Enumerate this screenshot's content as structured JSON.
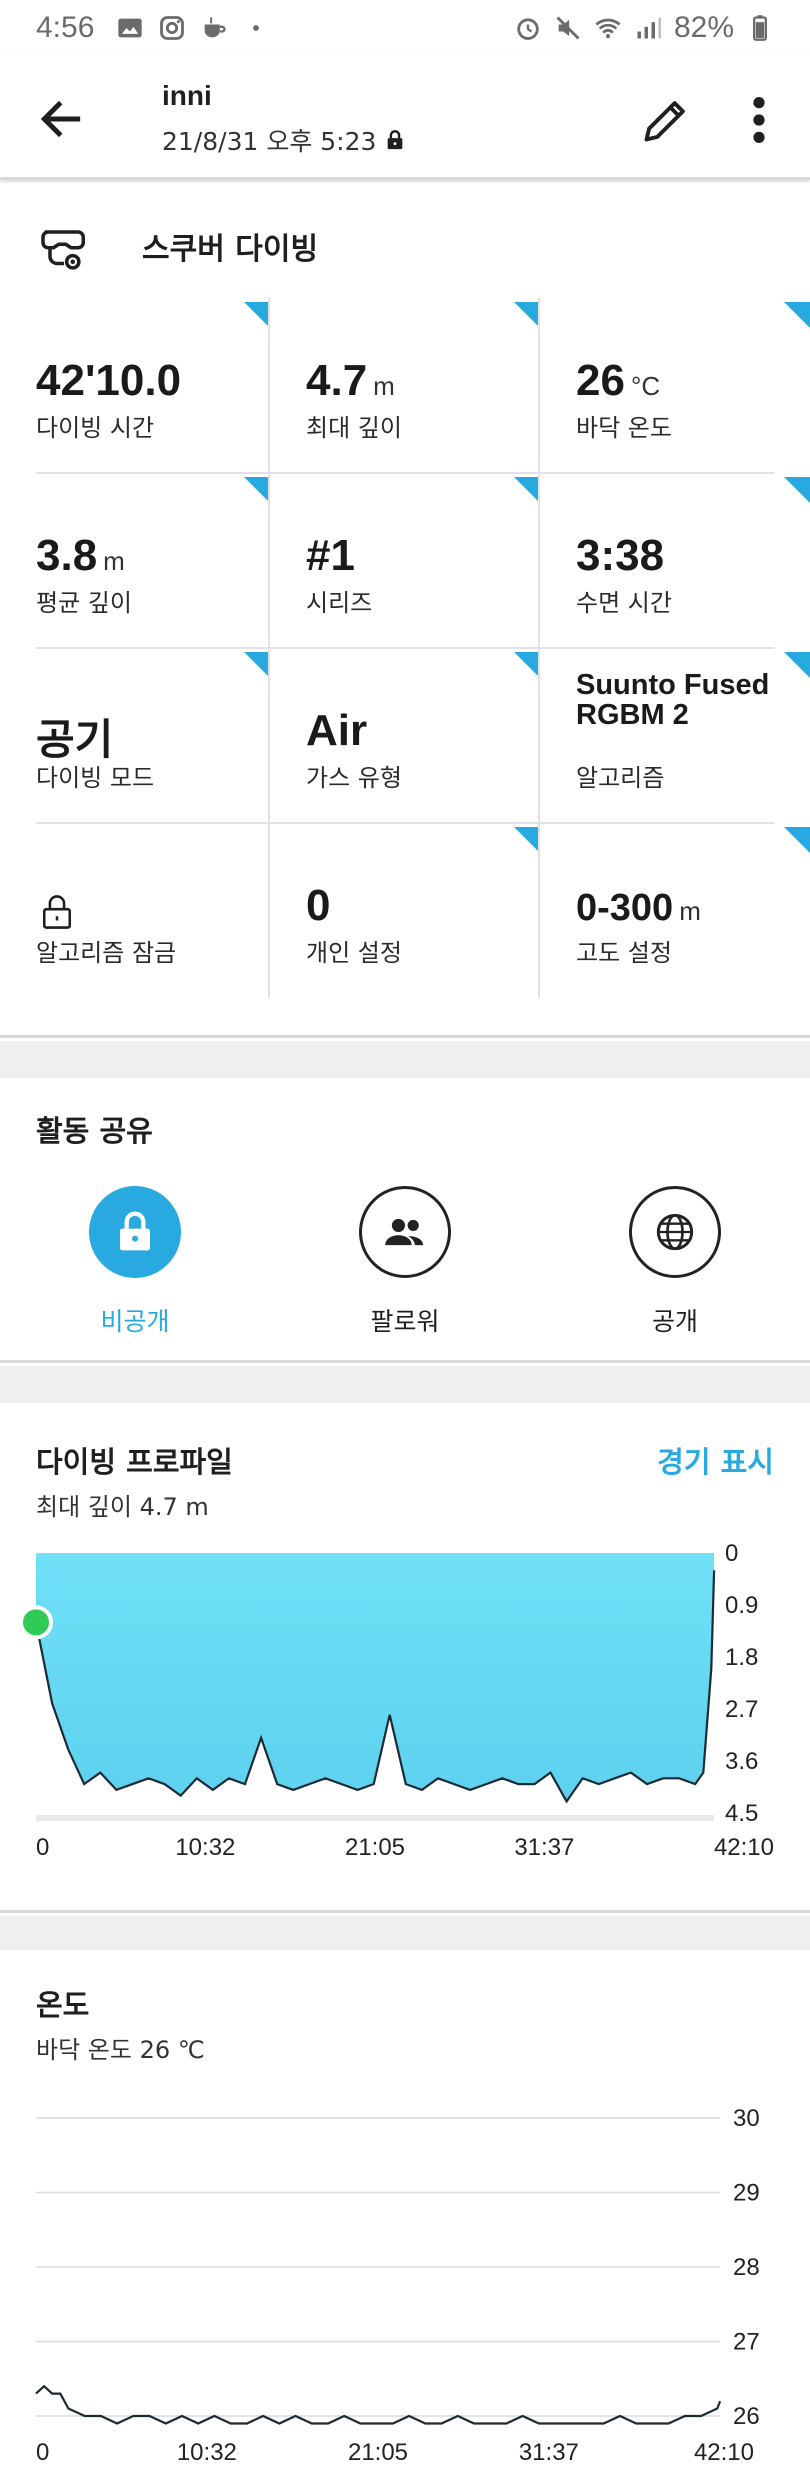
{
  "status_bar": {
    "time": "4:56",
    "battery": "82%",
    "icons": [
      "image-icon",
      "instagram-icon",
      "coffee-icon",
      "dot-icon",
      "alarm-icon",
      "mute-icon",
      "wifi-icon",
      "signal-icon",
      "battery-icon"
    ]
  },
  "header": {
    "title": "inni",
    "subtitle": "21/8/31 오후 5:23",
    "icons": [
      "back-arrow-icon",
      "lock-icon",
      "pencil-icon",
      "more-vert-icon"
    ]
  },
  "activity": {
    "icon": "scuba-icon",
    "label": "스쿠버 다이빙"
  },
  "stats": [
    {
      "value": "42'10.0",
      "unit": "",
      "label": "다이빙 시간"
    },
    {
      "value": "4.7",
      "unit": "m",
      "label": "최대 깊이"
    },
    {
      "value": "26",
      "unit": "°C",
      "label": "바닥 온도"
    },
    {
      "value": "3.8",
      "unit": "m",
      "label": "평균 깊이"
    },
    {
      "value": "#1",
      "unit": "",
      "label": "시리즈"
    },
    {
      "value": "3:38",
      "unit": "",
      "label": "수면 시간"
    },
    {
      "value": "공기",
      "unit": "",
      "label": "다이빙 모드"
    },
    {
      "value": "Air",
      "unit": "",
      "label": "가스 유형"
    },
    {
      "value": "Suunto Fused RGBM 2",
      "unit": "",
      "label": "알고리즘"
    },
    {
      "value": "",
      "unit": "",
      "label": "알고리즘 잠금",
      "icon": "padlock-icon"
    },
    {
      "value": "0",
      "unit": "",
      "label": "개인 설정"
    },
    {
      "value": "0-300",
      "unit": "m",
      "label": "고도 설정"
    }
  ],
  "accent_color": "#28a9e0",
  "share": {
    "title": "활동 공유",
    "options": [
      {
        "label": "비공개",
        "icon": "lock-icon",
        "selected": true
      },
      {
        "label": "팔로워",
        "icon": "people-icon",
        "selected": false
      },
      {
        "label": "공개",
        "icon": "globe-icon",
        "selected": false
      }
    ]
  },
  "profile": {
    "title": "다이빙 프로파일",
    "subtitle": "최대 깊이 4.7 m",
    "link": "경기 표시"
  },
  "temperature": {
    "title": "온도",
    "subtitle": "바닥 온도 26 ℃"
  },
  "chart_data": [
    {
      "type": "area",
      "x_ticks": [
        "0",
        "10:32",
        "21:05",
        "31:37",
        "42:10"
      ],
      "y_ticks": [
        "0",
        "0.9",
        "1.8",
        "2.7",
        "3.6",
        "4.5"
      ],
      "ylim": [
        0,
        4.5
      ],
      "y_inverted": true,
      "x": [
        0,
        1,
        2,
        3,
        4,
        5,
        7,
        8,
        9,
        10,
        11,
        12,
        13,
        14,
        15,
        16,
        17,
        18,
        19,
        20,
        21,
        22,
        23,
        24,
        25,
        26,
        27,
        28,
        29,
        30,
        31,
        32,
        33,
        34,
        35,
        36,
        37,
        38,
        39,
        40,
        41,
        41.5,
        42,
        42.17
      ],
      "values": [
        1.2,
        2.6,
        3.4,
        4.0,
        3.8,
        4.1,
        3.9,
        4.0,
        4.2,
        3.9,
        4.1,
        3.9,
        4.0,
        3.2,
        4.0,
        4.1,
        4.0,
        3.9,
        4.0,
        4.1,
        4.0,
        2.8,
        4.0,
        4.1,
        3.9,
        4.0,
        4.1,
        4.0,
        3.9,
        4.0,
        4.0,
        3.8,
        4.3,
        3.9,
        4.0,
        3.9,
        3.8,
        4.0,
        3.9,
        3.9,
        4.0,
        3.8,
        2.0,
        0.3
      ],
      "current_marker": {
        "x": 0,
        "y": 1.2
      },
      "colors": {
        "fill": "#5dd1ee",
        "line": "#1c2b33",
        "marker": "#2ecc55"
      }
    },
    {
      "type": "line",
      "x_ticks": [
        "0",
        "10:32",
        "21:05",
        "31:37",
        "42:10"
      ],
      "y_ticks": [
        "30",
        "29",
        "28",
        "27",
        "26"
      ],
      "ylim": [
        25.8,
        30
      ],
      "x": [
        0,
        0.5,
        1,
        1.5,
        2,
        3,
        4,
        5,
        6,
        7,
        8,
        9,
        10,
        11,
        12,
        13,
        14,
        15,
        16,
        17,
        18,
        19,
        20,
        21,
        22,
        23,
        24,
        25,
        26,
        27,
        28,
        29,
        30,
        31,
        32,
        33,
        34,
        35,
        36,
        37,
        38,
        39,
        40,
        41,
        42,
        42.17
      ],
      "values": [
        26.3,
        26.4,
        26.3,
        26.3,
        26.1,
        26.0,
        26.0,
        25.9,
        26.0,
        26.0,
        25.9,
        26.0,
        25.9,
        26.0,
        25.9,
        25.9,
        26.0,
        25.9,
        26.0,
        25.9,
        25.9,
        26.0,
        25.9,
        25.9,
        25.9,
        26.0,
        25.9,
        25.9,
        26.0,
        25.9,
        25.9,
        25.9,
        26.0,
        25.9,
        25.9,
        25.9,
        25.9,
        25.9,
        26.0,
        25.9,
        25.9,
        25.9,
        26.0,
        26.0,
        26.1,
        26.2
      ],
      "grid": true,
      "colors": {
        "line": "#1c2b33",
        "grid": "#dcdcdc"
      }
    }
  ]
}
